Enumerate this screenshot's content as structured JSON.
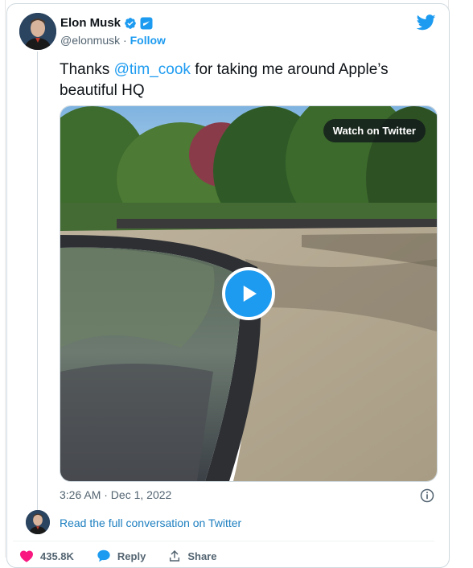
{
  "author": {
    "name": "Elon Musk",
    "handle": "@elonmusk",
    "separator": "·",
    "follow_label": "Follow"
  },
  "tweet": {
    "text_before": "Thanks ",
    "mention": "@tim_cook",
    "text_after": " for taking me around Apple’s beautiful HQ"
  },
  "media": {
    "watch_label": "Watch on Twitter"
  },
  "timestamp": "3:26 AM · Dec 1, 2022",
  "read_conversation": "Read the full conversation on Twitter",
  "actions": {
    "likes": "435.8K",
    "reply_label": "Reply",
    "share_label": "Share"
  },
  "icons": [
    "verified-icon",
    "gov-label-icon",
    "twitter-bird-icon",
    "play-icon",
    "info-icon",
    "heart-icon",
    "reply-icon",
    "share-icon"
  ],
  "colors": {
    "accent": "#1d9bf0",
    "like": "#f91880",
    "muted": "#536471"
  }
}
